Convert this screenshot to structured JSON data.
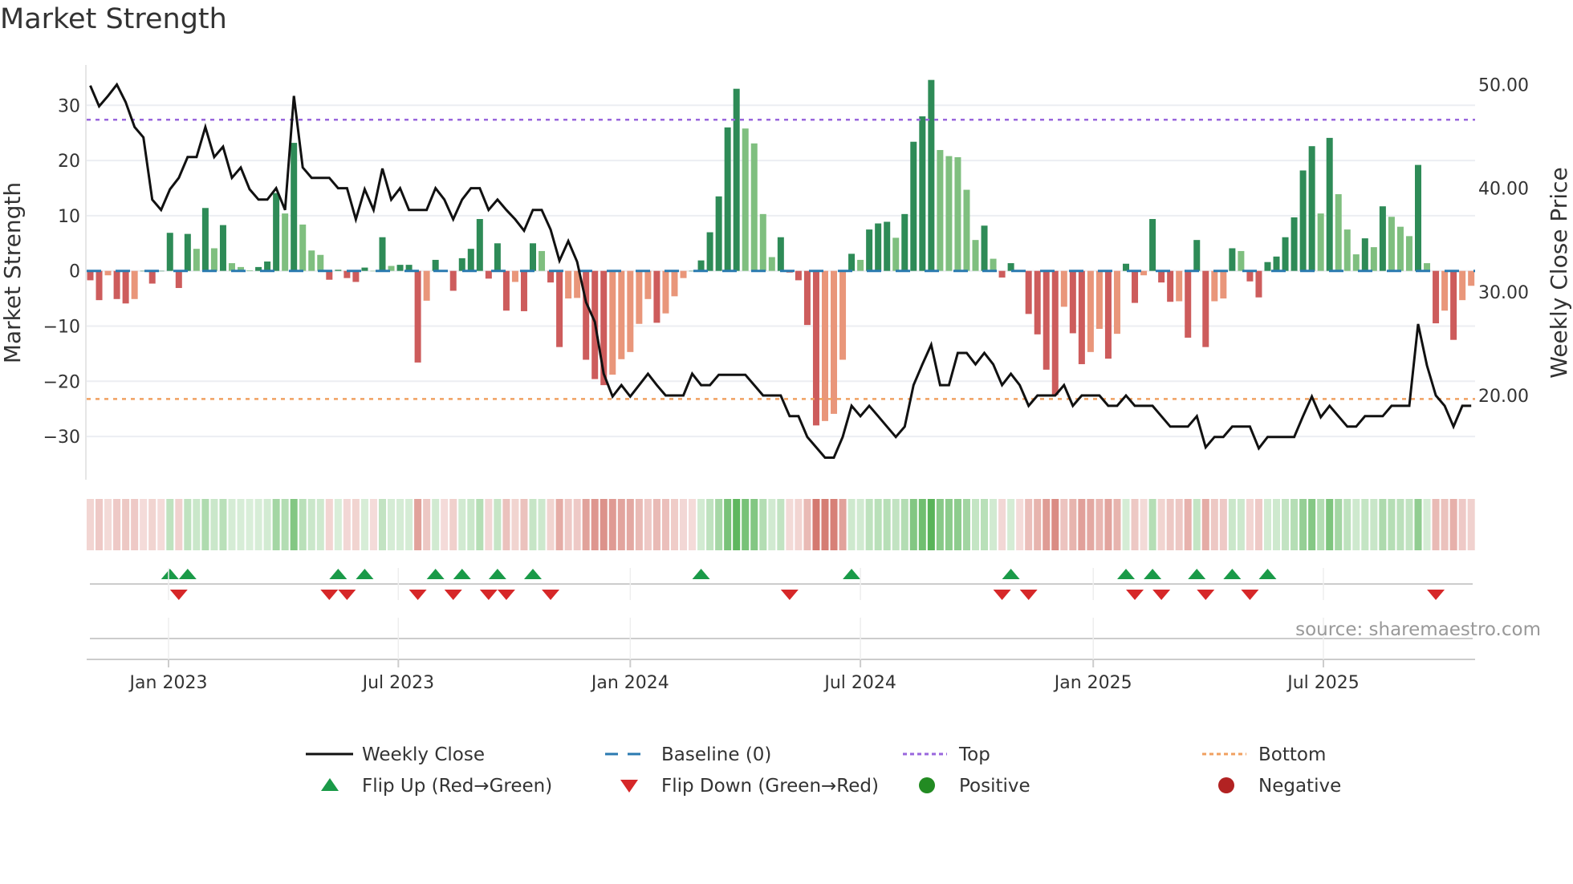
{
  "title": "Market Strength",
  "source": "source: sharemaestro.com",
  "colors": {
    "pos_strong": "#2e8b57",
    "pos_weak": "#7fbf7f",
    "neg_strong": "#cd5c5c",
    "neg_weak": "#e9967a",
    "price": "#111111",
    "baseline": "#2a7ab0",
    "top": "#9966dd",
    "bottom": "#f0a060",
    "flip_up": "#1a9a48",
    "flip_down": "#d62728",
    "positive": "#228b22",
    "negative": "#b22222",
    "heat_pos": "#2ca02c",
    "heat_neg": "#c0392b"
  },
  "chart_data": {
    "type": "bar",
    "title": "Market Strength",
    "ylabel": "Market Strength",
    "y2label": "Weekly Close Price",
    "ylim": [
      -37,
      36
    ],
    "y2lim": [
      12.9,
      52.5
    ],
    "yticks": [
      {
        "value": 30,
        "label": "30"
      },
      {
        "value": 20,
        "label": "20"
      },
      {
        "value": 10,
        "label": "10"
      },
      {
        "value": 0,
        "label": "0"
      },
      {
        "value": -10,
        "label": "−10"
      },
      {
        "value": -20,
        "label": "−20"
      },
      {
        "value": -30,
        "label": "−30"
      }
    ],
    "y2ticks": [
      {
        "value": 50,
        "label": "50.00"
      },
      {
        "value": 40,
        "label": "40.00"
      },
      {
        "value": 30,
        "label": "30.00"
      },
      {
        "value": 20,
        "label": "20.00"
      }
    ],
    "xticks": [
      {
        "week": 8.84,
        "label": "Jan 2023"
      },
      {
        "week": 34.8,
        "label": "Jul 2023"
      },
      {
        "week": 61.0,
        "label": "Jan 2024"
      },
      {
        "week": 87.0,
        "label": "Jul 2024"
      },
      {
        "week": 113.3,
        "label": "Jan 2025"
      },
      {
        "week": 139.3,
        "label": "Jul 2025"
      }
    ],
    "top_level": 27.4,
    "bottom_level": -23.2,
    "grid": true,
    "legend_position": "bottom",
    "legend": [
      {
        "key": "price",
        "label": "Weekly Close"
      },
      {
        "key": "baseline",
        "label": "Baseline (0)"
      },
      {
        "key": "top",
        "label": "Top"
      },
      {
        "key": "bottom",
        "label": "Bottom"
      },
      {
        "key": "flip_up",
        "label": "Flip Up (Red→Green)"
      },
      {
        "key": "flip_down",
        "label": "Flip Down (Green→Red)"
      },
      {
        "key": "positive",
        "label": "Positive"
      },
      {
        "key": "negative",
        "label": "Negative"
      }
    ],
    "strength": [
      -1.7,
      -5.3,
      -0.8,
      -5.1,
      -5.9,
      -5.1,
      0,
      -2.3,
      0,
      6.9,
      -3.1,
      6.7,
      4.0,
      11.4,
      4.1,
      8.3,
      1.4,
      0.7,
      0.1,
      0.7,
      1.7,
      14.1,
      10.4,
      23.2,
      8.4,
      3.7,
      2.9,
      -1.6,
      0.2,
      -1.3,
      -2.0,
      0.6,
      0,
      6.1,
      0.9,
      1.1,
      1.1,
      -16.6,
      -5.4,
      2.0,
      0,
      -3.6,
      2.3,
      4.0,
      9.4,
      -1.4,
      5.0,
      -7.2,
      -2.0,
      -7.3,
      5.0,
      3.6,
      -2.1,
      -13.8,
      -5.0,
      -4.9,
      -16.1,
      -19.6,
      -20.7,
      -18.8,
      -16.0,
      -14.7,
      -9.6,
      -5.1,
      -9.4,
      -7.7,
      -4.6,
      -1.3,
      0,
      1.9,
      7.0,
      13.5,
      26.0,
      33.0,
      25.8,
      23.1,
      10.3,
      2.5,
      6.1,
      -0.3,
      -1.7,
      -9.8,
      -28.0,
      -27.2,
      -25.9,
      -16.1,
      3.1,
      2.0,
      7.5,
      8.6,
      8.9,
      6.0,
      10.3,
      23.4,
      28.0,
      34.6,
      21.9,
      20.8,
      20.6,
      14.7,
      5.6,
      8.2,
      2.2,
      -1.2,
      1.4,
      0,
      -7.8,
      -11.5,
      -17.9,
      -22.5,
      -6.5,
      -11.3,
      -16.9,
      -14.7,
      -10.5,
      -15.9,
      -11.4,
      1.3,
      -5.8,
      -0.8,
      9.4,
      -2.1,
      -5.6,
      -5.5,
      -12.1,
      5.6,
      -13.8,
      -5.5,
      -5.0,
      4.1,
      3.6,
      -1.9,
      -4.8,
      1.6,
      2.6,
      6.1,
      9.7,
      18.2,
      22.6,
      10.4,
      24.1,
      13.9,
      7.5,
      3.0,
      5.9,
      4.3,
      11.7,
      9.8,
      8.0,
      6.3,
      19.2,
      1.4,
      -9.5,
      -7.2,
      -12.5,
      -5.3,
      -2.7
    ],
    "price": [
      49.9,
      47.9,
      48.9,
      50.0,
      48.3,
      45.9,
      44.9,
      38.9,
      37.9,
      39.9,
      41.0,
      43.0,
      43.0,
      45.9,
      43.0,
      44.0,
      41.0,
      42.0,
      39.9,
      38.9,
      38.9,
      40.0,
      37.9,
      48.9,
      42.0,
      41.0,
      41.0,
      41.0,
      40.0,
      40.0,
      37.0,
      39.9,
      37.9,
      41.9,
      38.9,
      40.0,
      37.9,
      37.9,
      37.9,
      40.0,
      38.9,
      37.0,
      38.9,
      40.0,
      40.0,
      37.9,
      38.9,
      37.9,
      37.0,
      35.9,
      37.9,
      37.9,
      36.0,
      33.0,
      34.9,
      32.9,
      29.0,
      27.1,
      22.1,
      19.9,
      21.0,
      19.9,
      21.0,
      22.1,
      21.0,
      20.0,
      20.0,
      20.0,
      22.1,
      21.0,
      21.0,
      22.0,
      22.0,
      22.0,
      22.0,
      21.0,
      20.0,
      20.0,
      20.0,
      18.0,
      18.0,
      16.0,
      15.0,
      14.0,
      14.0,
      16.0,
      19.0,
      18.0,
      19.0,
      18.0,
      17.0,
      16.0,
      17.0,
      21.0,
      23.0,
      24.9,
      21.0,
      21.0,
      24.1,
      24.1,
      23.0,
      24.1,
      23.0,
      21.0,
      22.1,
      21.0,
      19.0,
      20.0,
      20.0,
      20.0,
      21.0,
      19.0,
      20.0,
      20.0,
      20.0,
      19.0,
      19.0,
      20.0,
      19.0,
      19.0,
      19.0,
      18.0,
      17.0,
      17.0,
      17.0,
      18.0,
      15.0,
      16.0,
      16.0,
      17.0,
      17.0,
      17.0,
      14.9,
      16.0,
      16.0,
      16.0,
      16.0,
      18.0,
      19.9,
      17.9,
      19.0,
      18.0,
      17.0,
      17.0,
      18.0,
      18.0,
      18.0,
      19.0,
      19.0,
      19.0,
      26.9,
      22.9,
      20.0,
      19.0,
      17.0,
      19.0,
      19.0
    ]
  }
}
